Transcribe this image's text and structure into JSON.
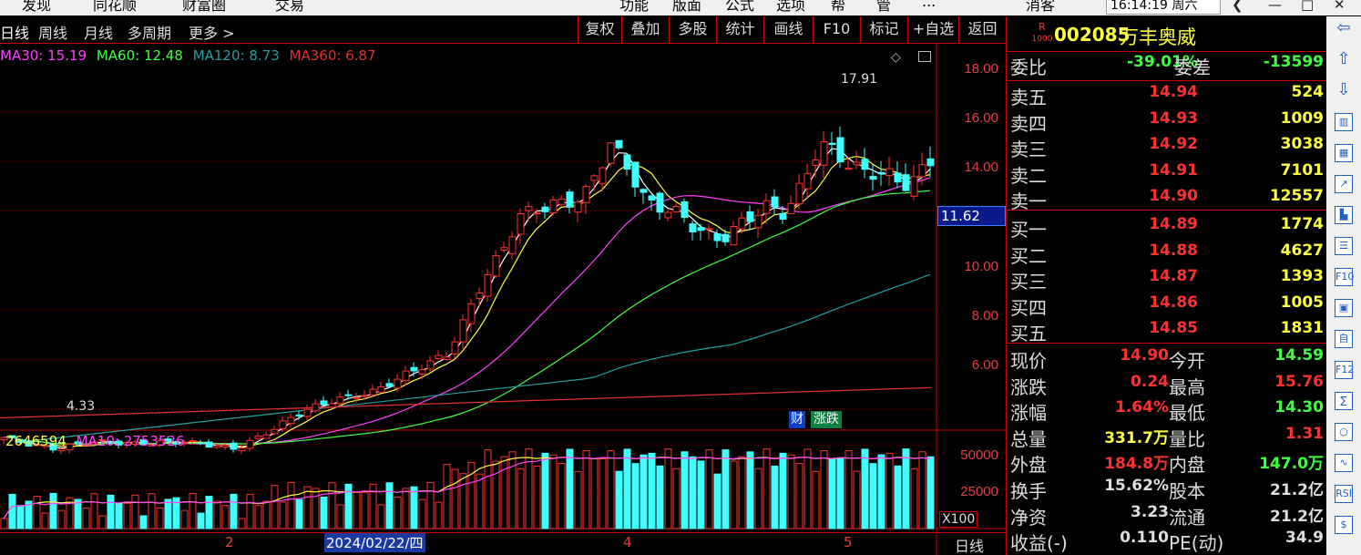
{
  "menubar": {
    "items": [
      "发现",
      "同花顺",
      "财富圈",
      "交易",
      "功能",
      "版面",
      "公式",
      "选项",
      "帮",
      "管",
      "...",
      "消客"
    ],
    "time": "16:14:19 周六"
  },
  "tabs": {
    "period_tabs": [
      "日线",
      "周线",
      "月线",
      "多周期",
      "更多 >"
    ],
    "right_buttons": [
      "复权",
      "叠加",
      "多股",
      "统计",
      "画线",
      "F10",
      "标记",
      "+自选",
      "返回"
    ]
  },
  "indicators": {
    "main": [
      {
        "label": "MA30: 15.19",
        "color": "#ff40ff"
      },
      {
        "label": "MA60: 12.48",
        "color": "#40ff40"
      },
      {
        "label": "MA120: 8.73",
        "color": "#20a0a0"
      },
      {
        "label": "MA360: 6.87",
        "color": "#e03030"
      }
    ],
    "vol": [
      {
        "label": "2646594",
        "color": "#ffff40"
      },
      {
        "label": "MA10: 2753526",
        "color": "#ff40ff"
      }
    ]
  },
  "price_axis": {
    "ticks": [
      "18.00",
      "16.00",
      "14.00",
      "10.00",
      "8.00",
      "6.00"
    ],
    "current": "11.62"
  },
  "vol_axis": {
    "ticks": [
      "50000",
      "25000"
    ],
    "unit": "X100"
  },
  "chart_labels": {
    "high": "17.91",
    "low": "4.33",
    "badge1": "财",
    "badge2": "涨跌"
  },
  "x_axis": {
    "labels": [
      "2",
      "2024/02/22/四",
      "4",
      "5"
    ],
    "period": "日线"
  },
  "stock": {
    "code": "002085",
    "name": "万丰奥威",
    "badge_top": "R",
    "badge_bottom": "1000"
  },
  "quote": {
    "weibi": {
      "label": "委比",
      "value": "-39.01%",
      "label2": "委差",
      "value2": "-13599"
    },
    "asks": [
      {
        "label": "卖五",
        "price": "14.94",
        "vol": "524"
      },
      {
        "label": "卖四",
        "price": "14.93",
        "vol": "1009"
      },
      {
        "label": "卖三",
        "price": "14.92",
        "vol": "3038"
      },
      {
        "label": "卖二",
        "price": "14.91",
        "vol": "7101"
      },
      {
        "label": "卖一",
        "price": "14.90",
        "vol": "12557"
      }
    ],
    "bids": [
      {
        "label": "买一",
        "price": "14.89",
        "vol": "1774"
      },
      {
        "label": "买二",
        "price": "14.88",
        "vol": "4627"
      },
      {
        "label": "买三",
        "price": "14.87",
        "vol": "1393"
      },
      {
        "label": "买四",
        "price": "14.86",
        "vol": "1005"
      },
      {
        "label": "买五",
        "price": "14.85",
        "vol": "1831"
      }
    ],
    "stats": [
      {
        "l1": "现价",
        "v1": "14.90",
        "c1": "#ff3030",
        "l2": "今开",
        "v2": "14.59",
        "c2": "#40ff40"
      },
      {
        "l1": "涨跌",
        "v1": "0.24",
        "c1": "#ff3030",
        "l2": "最高",
        "v2": "15.76",
        "c2": "#ff3030"
      },
      {
        "l1": "涨幅",
        "v1": "1.64%",
        "c1": "#ff3030",
        "l2": "最低",
        "v2": "14.30",
        "c2": "#40ff40"
      },
      {
        "l1": "总量",
        "v1": "331.7万",
        "c1": "#ffff40",
        "l2": "量比",
        "v2": "1.31",
        "c2": "#ff3030"
      },
      {
        "l1": "外盘",
        "v1": "184.8万",
        "c1": "#ff3030",
        "l2": "内盘",
        "v2": "147.0万",
        "c2": "#40ff40"
      },
      {
        "l1": "换手",
        "v1": "15.62%",
        "c1": "#ddd",
        "l2": "股本",
        "v2": "21.2亿",
        "c2": "#ddd"
      },
      {
        "l1": "净资",
        "v1": "3.23",
        "c1": "#ddd",
        "l2": "流通",
        "v2": "21.2亿",
        "c2": "#ddd"
      },
      {
        "l1": "收益(-)",
        "v1": "0.110",
        "c1": "#ddd",
        "l2": "PE(动)",
        "v2": "34.9",
        "c2": "#ddd"
      }
    ]
  },
  "toolbar_icons": [
    "arrow-left-icon",
    "arrow-up-icon",
    "arrow-down-icon",
    "kline-icon",
    "grid-icon",
    "trend-icon",
    "candle-icon",
    "list-icon",
    "f10-icon",
    "note-icon",
    "info-icon",
    "f12-icon",
    "calc-icon",
    "circle-icon",
    "wave-icon",
    "rsi-icon",
    "dollar-icon"
  ],
  "toolbar_labels": [
    "",
    "",
    "",
    "",
    "",
    "",
    "",
    "",
    "F10",
    "",
    "自",
    "F12",
    "",
    "",
    "",
    "RSI",
    "$"
  ],
  "colors": {
    "up": "#ff3030",
    "down": "#40ffff",
    "ma5": "#ffffff",
    "ma10": "#ffff40",
    "ma30": "#ff40ff",
    "ma60": "#40ff40",
    "ma120": "#20a0a0",
    "ma360": "#e03030"
  }
}
